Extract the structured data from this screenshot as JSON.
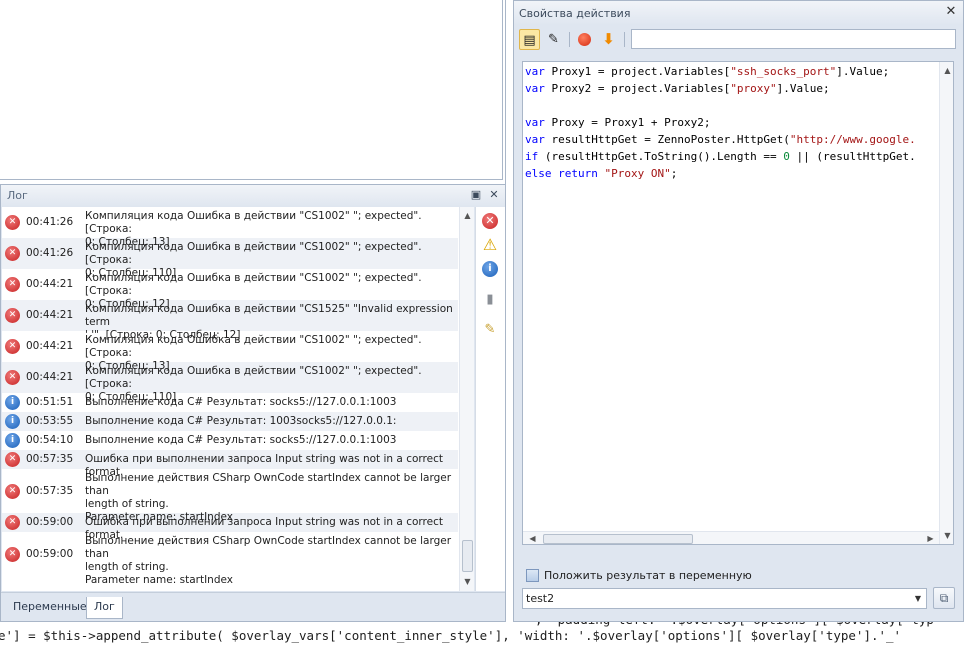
{
  "background_code": {
    "line1_prefix": "’",
    "line1_text": "', 'padding-left: '.$overlay['options'][ $overlay['typ",
    "line2_text": "e'] = $this->append_attribute( $overlay_vars['content_inner_style'], 'width: '.$overlay['options'][ $overlay['type'].'_'"
  },
  "log": {
    "title": "Лог",
    "rows": [
      {
        "level": "error",
        "time": "00:41:26",
        "message": "Компиляция кода  Ошибка в действии \"CS1002\" \"; expected\". [Строка:\n0; Столбец: 13]"
      },
      {
        "level": "error",
        "time": "00:41:26",
        "message": "Компиляция кода  Ошибка в действии \"CS1002\" \"; expected\". [Строка:\n0; Столбец: 110]"
      },
      {
        "level": "error",
        "time": "00:44:21",
        "message": "Компиляция кода  Ошибка в действии \"CS1002\" \"; expected\". [Строка:\n0; Столбец: 12]"
      },
      {
        "level": "error",
        "time": "00:44:21",
        "message": "Компиляция кода  Ошибка в действии \"CS1525\" \"Invalid expression term\n'.'\". [Строка: 0; Столбец: 12]"
      },
      {
        "level": "error",
        "time": "00:44:21",
        "message": "Компиляция кода  Ошибка в действии \"CS1002\" \"; expected\". [Строка:\n0; Столбец: 13]"
      },
      {
        "level": "error",
        "time": "00:44:21",
        "message": "Компиляция кода  Ошибка в действии \"CS1002\" \"; expected\". [Строка:\n0; Столбец: 110]"
      },
      {
        "level": "info",
        "time": "00:51:51",
        "message": "Выполнение кода C#  Результат: socks5://127.0.0.1:1003"
      },
      {
        "level": "info",
        "time": "00:53:55",
        "message": "Выполнение кода C#  Результат: 1003socks5://127.0.0.1:"
      },
      {
        "level": "info",
        "time": "00:54:10",
        "message": "Выполнение кода C#  Результат: socks5://127.0.0.1:1003"
      },
      {
        "level": "error",
        "time": "00:57:35",
        "message": "Ошибка при выполнении запроса Input string was not in a correct format."
      },
      {
        "level": "error",
        "time": "00:57:35",
        "message": "Выполнение действия CSharp OwnCode startIndex cannot be larger than\nlength of string.\nParameter name: startIndex"
      },
      {
        "level": "error",
        "time": "00:59:00",
        "message": "Ошибка при выполнении запроса Input string was not in a correct format."
      },
      {
        "level": "error",
        "time": "00:59:00",
        "message": "Выполнение действия CSharp OwnCode startIndex cannot be larger than\nlength of string.\nParameter name: startIndex"
      }
    ],
    "tabs": [
      {
        "label": "Переменные",
        "active": false
      },
      {
        "label": "Лог",
        "active": true
      }
    ]
  },
  "properties": {
    "title": "Свойства действия",
    "search_value": "",
    "code_lines": [
      [
        {
          "t": "var",
          "c": "kw"
        },
        {
          "t": " Proxy1 = project.Variables["
        },
        {
          "t": "\"ssh_socks_port\"",
          "c": "str"
        },
        {
          "t": "].Value;"
        }
      ],
      [
        {
          "t": "var",
          "c": "kw"
        },
        {
          "t": " Proxy2 = project.Variables["
        },
        {
          "t": "\"proxy\"",
          "c": "str"
        },
        {
          "t": "].Value;"
        }
      ],
      [],
      [
        {
          "t": "var",
          "c": "kw"
        },
        {
          "t": " Proxy = Proxy1 + Proxy2;"
        }
      ],
      [
        {
          "t": "var",
          "c": "kw"
        },
        {
          "t": " resultHttpGet = ZennoPoster.HttpGet("
        },
        {
          "t": "\"http://www.google.",
          "c": "str"
        }
      ],
      [
        {
          "t": "if",
          "c": "kw"
        },
        {
          "t": " (resultHttpGet.ToString().Length == "
        },
        {
          "t": "0",
          "c": "num"
        },
        {
          "t": " || (resultHttpGet."
        }
      ],
      [
        {
          "t": "else",
          "c": "kw"
        },
        {
          "t": " "
        },
        {
          "t": "return",
          "c": "kw"
        },
        {
          "t": " "
        },
        {
          "t": "\"Proxy ON\"",
          "c": "str"
        },
        {
          "t": ";"
        }
      ]
    ],
    "save_to_variable_label": "Положить результат в переменную",
    "save_to_variable_checked": true,
    "variable_value": "test2"
  }
}
